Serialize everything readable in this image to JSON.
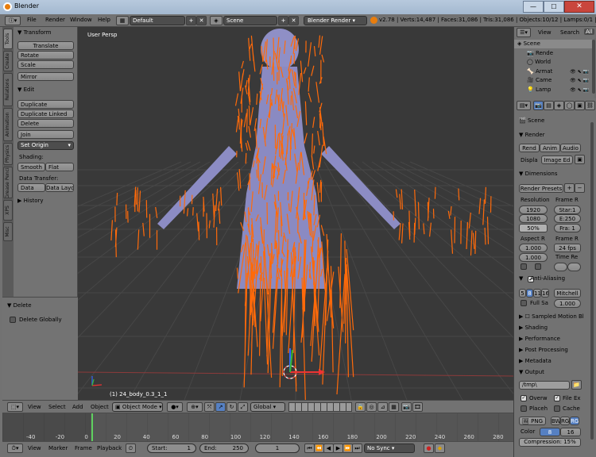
{
  "window": {
    "title": "Blender",
    "min": "—",
    "max": "☐",
    "close": "✕"
  },
  "topbar": {
    "menus": [
      "File",
      "Render",
      "Window",
      "Help"
    ],
    "layout": "Default",
    "scene": "Scene",
    "engine": "Blender Render",
    "stats": "v2.78 | Verts:14,487 | Faces:31,086 | Tris:31,086 | Objects:10/12 | Lamps:0/1 | Mem:28.18"
  },
  "toolshelf": {
    "tabs": [
      "Tools",
      "Create",
      "Relations",
      "Animation",
      "Physics",
      "Grease Pencil",
      "XPS",
      "Misc"
    ],
    "transform_header": "Transform",
    "translate": "Translate",
    "rotate": "Rotate",
    "scale": "Scale",
    "mirror": "Mirror",
    "edit_header": "Edit",
    "duplicate": "Duplicate",
    "duplicate_linked": "Duplicate Linked",
    "delete": "Delete",
    "join": "Join",
    "set_origin": "Set Origin",
    "shading_label": "Shading:",
    "smooth": "Smooth",
    "flat": "Flat",
    "data_transfer_label": "Data Transfer:",
    "data": "Data",
    "data_layout": "Data Layo",
    "history_header": "History",
    "op_header": "Delete",
    "delete_globally": "Delete Globally"
  },
  "viewport": {
    "view_label": "User Persp",
    "object_label": "(1) 24_body_0.3_1_1"
  },
  "view3d_header": {
    "view": "View",
    "select": "Select",
    "add": "Add",
    "object": "Object",
    "mode": "Object Mode",
    "orientation": "Global"
  },
  "timeline": {
    "ticks": [
      "-40",
      "-20",
      "0",
      "20",
      "40",
      "60",
      "80",
      "100",
      "120",
      "140",
      "160",
      "180",
      "200",
      "220",
      "240",
      "260",
      "280"
    ],
    "menus": [
      "View",
      "Marker",
      "Frame",
      "Playback"
    ],
    "start_label": "Start:",
    "start": "1",
    "end_label": "End:",
    "end": "250",
    "current": "1",
    "sync": "No Sync"
  },
  "outliner": {
    "view": "View",
    "search": "Search",
    "all": "All",
    "items": [
      "Scene",
      "Rende",
      "World",
      "Armat",
      "Came",
      "Lamp"
    ]
  },
  "properties": {
    "scene": "Scene",
    "render_header": "Render",
    "render_btn": "Rend",
    "anim_btn": "Anim",
    "audio_btn": "Audio",
    "display_label": "Displa",
    "display_value": "Image Ed",
    "dimensions_header": "Dimensions",
    "render_presets": "Render Presets",
    "resolution_label": "Resolution",
    "res_x": "1920",
    "res_y": "1080",
    "res_pct": "50%",
    "frame_range_label": "Frame R",
    "start_frame": "Star:1",
    "end_frame": "E:250",
    "frame_step": "Fra: 1",
    "aspect_label": "Aspect R",
    "aspect_x": "1.000",
    "aspect_y": "1.000",
    "frame_rate_label": "Frame R",
    "fps": "24 fps",
    "time_remap_label": "Time Re",
    "aa_header": "Anti-Aliasing",
    "aa_samples": [
      "5",
      "8",
      "11",
      "16"
    ],
    "aa_filter": "Mitchell",
    "full_sample": "Full Sa",
    "filter_size": "1.000",
    "sampled_motion": "Sampled Motion Bl",
    "shading_header": "Shading",
    "performance_header": "Performance",
    "post_processing_header": "Post Processing",
    "metadata_header": "Metadata",
    "output_header": "Output",
    "output_path": "/tmp\\",
    "overwrite": "Overw",
    "file_ext": "File Ex",
    "placeholders": "Placeh",
    "cache": "Cache",
    "format": "PNG",
    "bw": "BW",
    "rgb": "RG",
    "rgba": "RG",
    "color_label": "Color",
    "depth_8": "8",
    "depth_16": "16",
    "compression": "Compression:",
    "compression_val": "15%"
  }
}
